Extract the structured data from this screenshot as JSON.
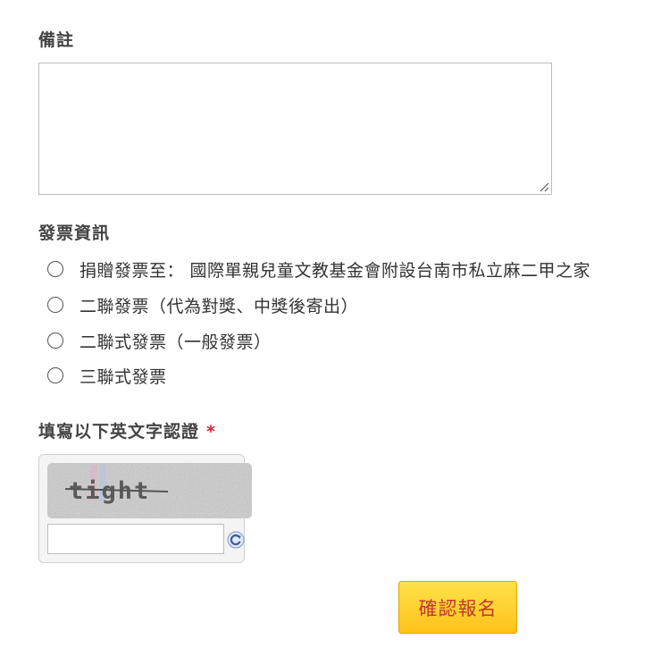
{
  "notes": {
    "label": "備註",
    "value": ""
  },
  "invoice": {
    "label": "發票資訊",
    "options": [
      {
        "label": "捐贈發票至： 國際單親兒童文教基金會附設台南市私立麻二甲之家",
        "selected": false
      },
      {
        "label": "二聯發票（代為對獎、中獎後寄出）",
        "selected": false
      },
      {
        "label": "二聯式發票（一般發票）",
        "selected": false
      },
      {
        "label": "三聯式發票",
        "selected": false
      }
    ]
  },
  "captcha": {
    "label": "填寫以下英文字認證",
    "required_marker": "*",
    "image_text": "tight",
    "input_value": "",
    "refresh_icon": "refresh-icon"
  },
  "submit": {
    "label": "確認報名"
  },
  "colors": {
    "required": "#d9232e",
    "button_bg": "#ffc21a",
    "button_text": "#c0392b"
  }
}
